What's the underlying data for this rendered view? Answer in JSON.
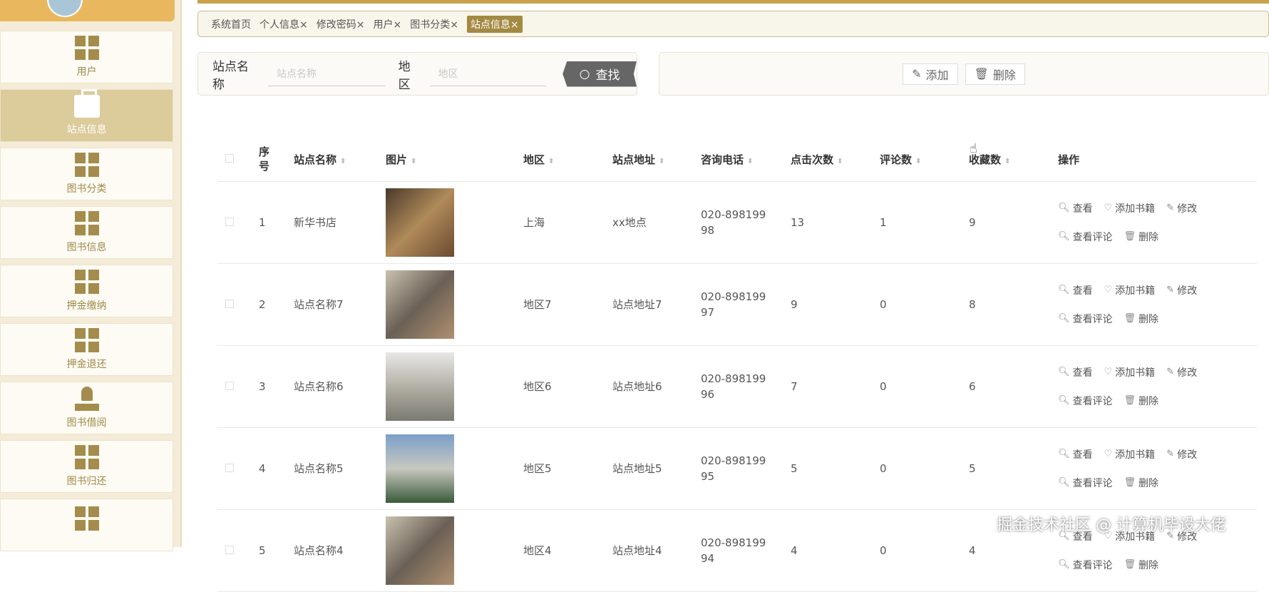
{
  "sidebar": {
    "items": [
      {
        "label": "用户",
        "icon": "grid"
      },
      {
        "label": "站点信息",
        "icon": "bag",
        "active": true
      },
      {
        "label": "图书分类",
        "icon": "grid"
      },
      {
        "label": "图书信息",
        "icon": "grid"
      },
      {
        "label": "押金缴纳",
        "icon": "grid"
      },
      {
        "label": "押金退还",
        "icon": "grid"
      },
      {
        "label": "图书借阅",
        "icon": "stamp"
      },
      {
        "label": "图书归还",
        "icon": "grid"
      }
    ]
  },
  "tabs": [
    "系统首页",
    "个人信息×",
    "修改密码×",
    "用户×",
    "图书分类×",
    "站点信息×"
  ],
  "search": {
    "name_label": "站点名称",
    "name_placeholder": "站点名称",
    "region_label": "地区",
    "region_placeholder": "地区",
    "find": "查找"
  },
  "actions": {
    "add": "添加",
    "delete": "删除"
  },
  "columns": [
    "序号",
    "站点名称",
    "图片",
    "地区",
    "站点地址",
    "咨询电话",
    "点击次数",
    "评论数",
    "收藏数",
    "操作"
  ],
  "ops": {
    "view": "查看",
    "add_books": "添加书籍",
    "edit": "修改",
    "view_comments": "查看评论",
    "delete": "删除"
  },
  "rows": [
    {
      "no": "1",
      "name": "新华书店",
      "region": "上海",
      "address": "xx地点",
      "phone": "020-89819998",
      "clicks": "13",
      "comments": "1",
      "favs": "9"
    },
    {
      "no": "2",
      "name": "站点名称7",
      "region": "地区7",
      "address": "站点地址7",
      "phone": "020-89819997",
      "clicks": "9",
      "comments": "0",
      "favs": "8"
    },
    {
      "no": "3",
      "name": "站点名称6",
      "region": "地区6",
      "address": "站点地址6",
      "phone": "020-89819996",
      "clicks": "7",
      "comments": "0",
      "favs": "6"
    },
    {
      "no": "4",
      "name": "站点名称5",
      "region": "地区5",
      "address": "站点地址5",
      "phone": "020-89819995",
      "clicks": "5",
      "comments": "0",
      "favs": "5"
    },
    {
      "no": "5",
      "name": "站点名称4",
      "region": "地区4",
      "address": "站点地址4",
      "phone": "020-89819994",
      "clicks": "4",
      "comments": "0",
      "favs": "4"
    }
  ],
  "watermark": "掘金技术社区 @ 计算机毕设大佬"
}
